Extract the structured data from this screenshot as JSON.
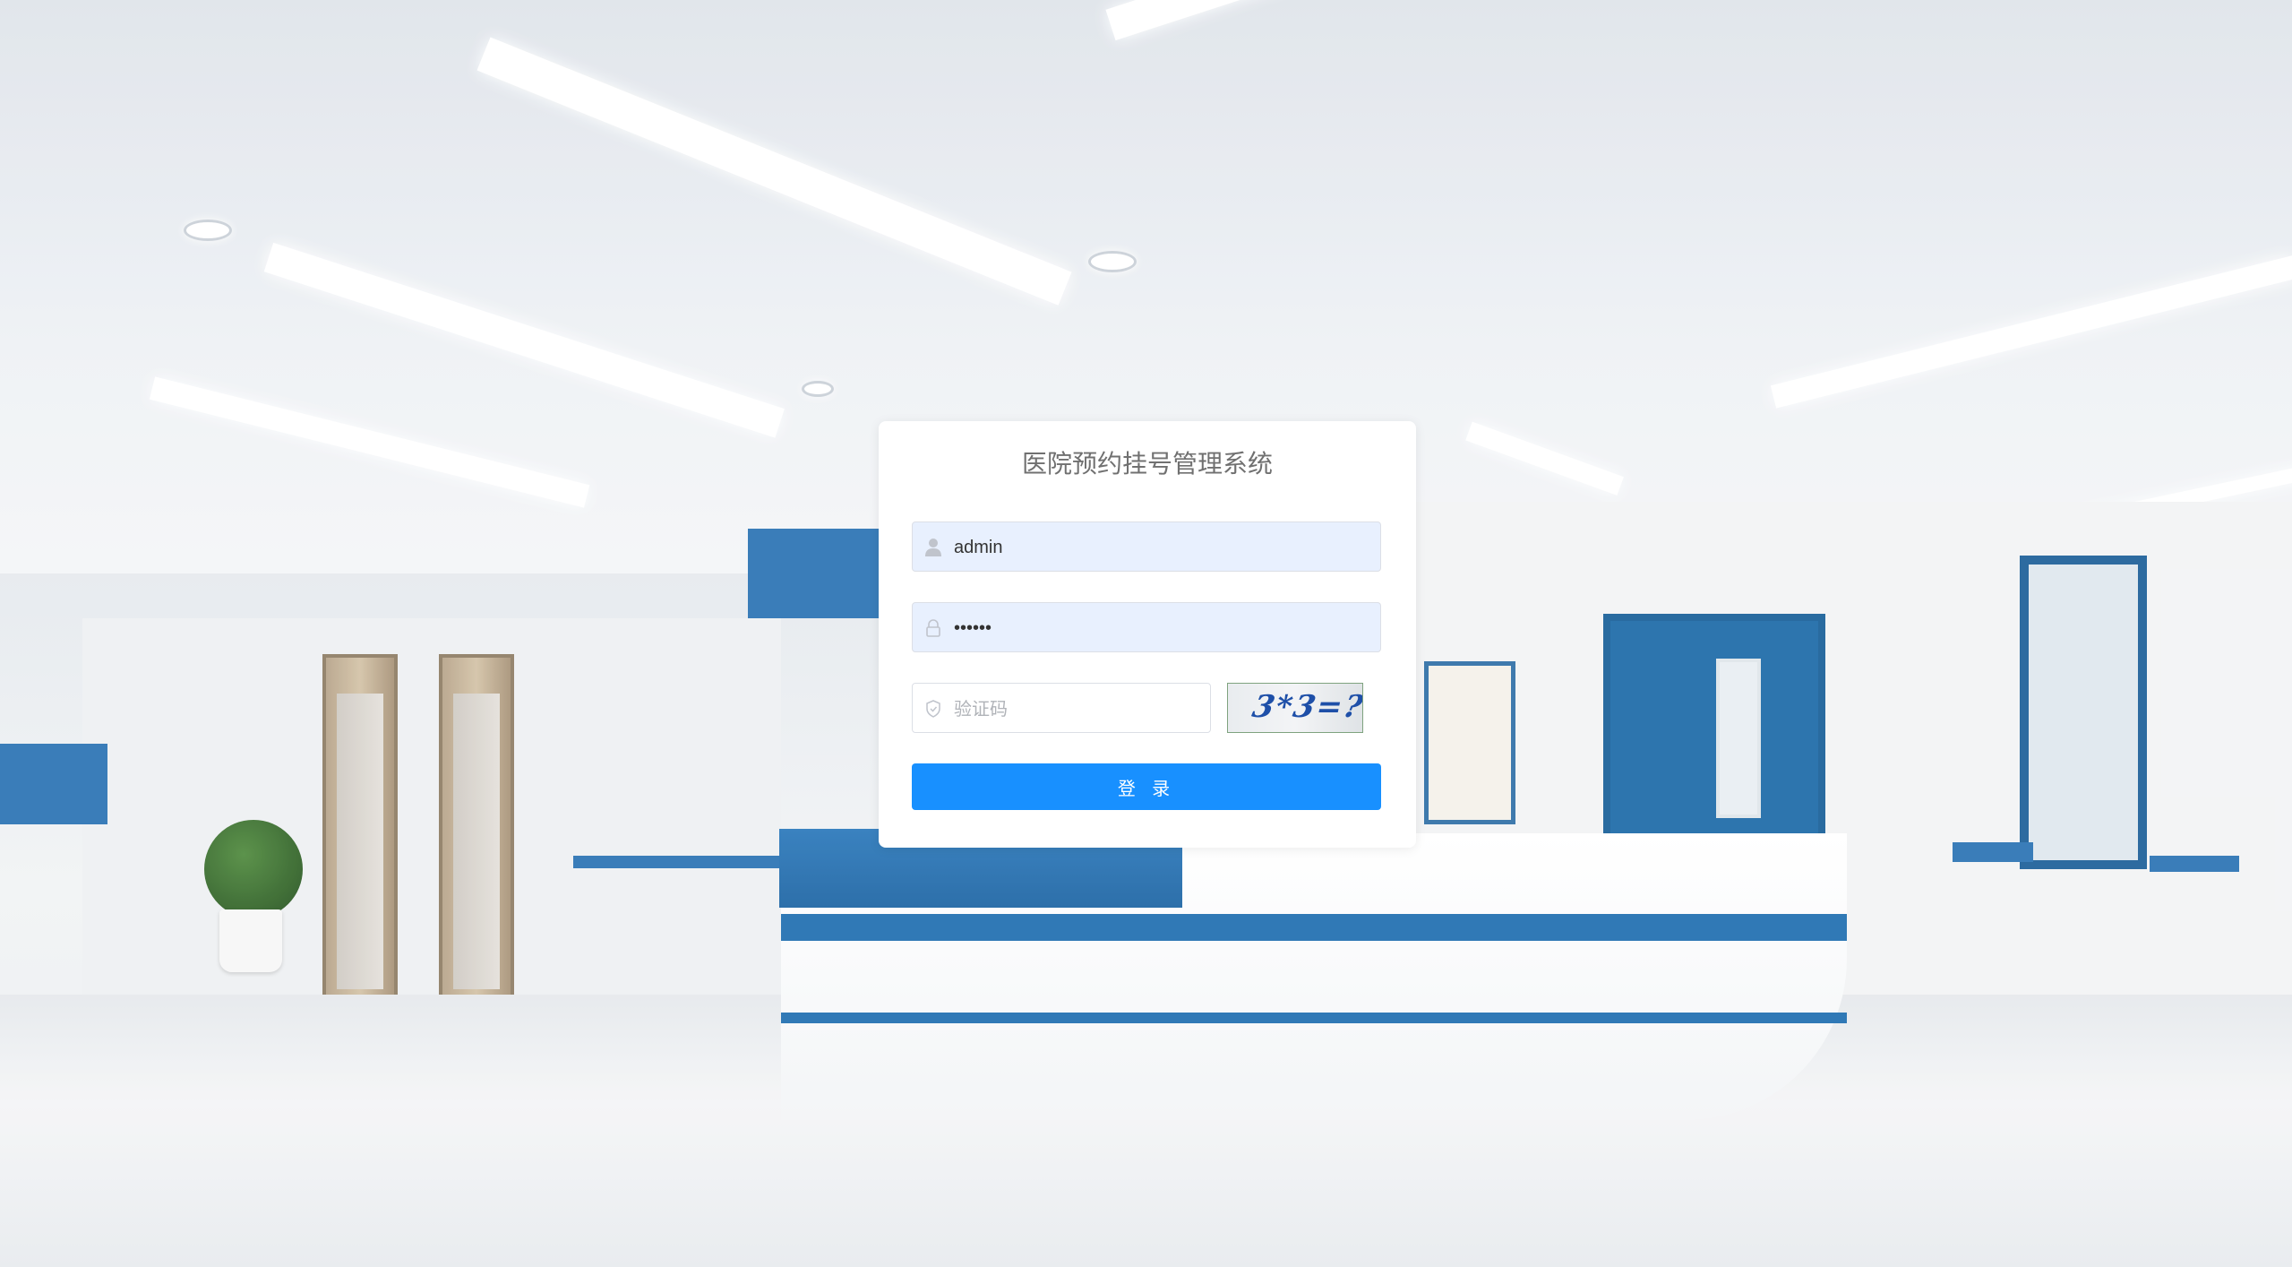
{
  "login": {
    "title": "医院预约挂号管理系统",
    "username_value": "admin",
    "password_value": "••••••",
    "captcha_placeholder": "验证码",
    "captcha_text": "3*3=?",
    "login_label": "登 录"
  },
  "icons": {
    "username": "user-icon",
    "password": "lock-icon",
    "captcha": "shield-icon"
  },
  "colors": {
    "primary": "#1890ff",
    "autofill_bg": "#e8f0fe",
    "title_text": "#707070"
  }
}
